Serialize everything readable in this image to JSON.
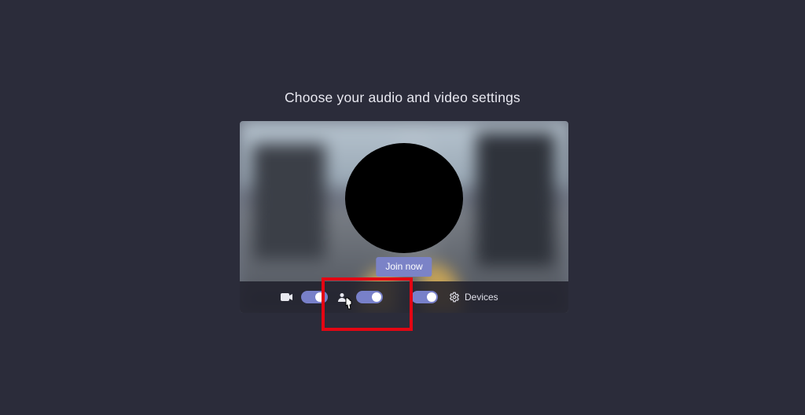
{
  "heading": "Choose your audio and video settings",
  "join_button_label": "Join now",
  "devices_label": "Devices",
  "toggles": {
    "video": {
      "on": true
    },
    "background_blur": {
      "on": true
    },
    "mic": {
      "on": true
    }
  },
  "icons": {
    "camera": "camera-icon",
    "gear": "gear-icon",
    "pointer": "pointer-cursor-icon"
  }
}
